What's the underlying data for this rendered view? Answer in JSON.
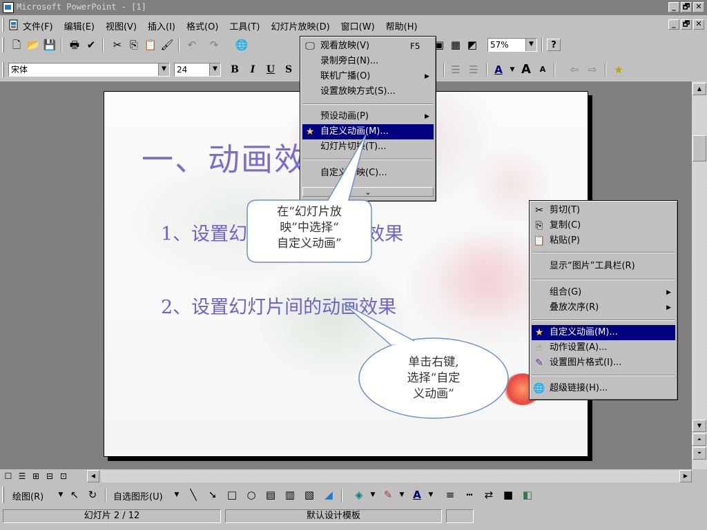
{
  "window": {
    "title": "Microsoft PowerPoint - [1]",
    "controls": [
      "_",
      "🗗",
      "✕"
    ]
  },
  "menubar": {
    "items": [
      "文件(F)",
      "编辑(E)",
      "视图(V)",
      "插入(I)",
      "格式(O)",
      "工具(T)",
      "幻灯片放映(D)",
      "窗口(W)",
      "帮助(H)"
    ]
  },
  "std_toolbar": {
    "zoom": "57%"
  },
  "fmt_toolbar": {
    "font": "宋体",
    "size": "24",
    "bold": "B",
    "italic": "I",
    "underline": "U",
    "shadow": "S"
  },
  "slideshow_menu": {
    "items": [
      {
        "label": "观看放映(V)",
        "shortcut": "F5"
      },
      {
        "label": "录制旁白(N)..."
      },
      {
        "label": "联机广播(O)"
      },
      {
        "label": "设置放映方式(S)..."
      },
      {
        "label": "预设动画(P)"
      },
      {
        "label": "自定义动画(M)..."
      },
      {
        "label": "幻灯片切换(T)..."
      },
      {
        "label": "自定义放映(C)..."
      }
    ],
    "expand": "⌄"
  },
  "context_menu": {
    "items": [
      {
        "label": "剪切(T)"
      },
      {
        "label": "复制(C)"
      },
      {
        "label": "粘贴(P)"
      },
      {
        "label": "显示“图片”工具栏(R)"
      },
      {
        "label": "组合(G)"
      },
      {
        "label": "叠放次序(R)"
      },
      {
        "label": "自定义动画(M)..."
      },
      {
        "label": "动作设置(A)..."
      },
      {
        "label": "设置图片格式(I)..."
      },
      {
        "label": "超级链接(H)..."
      }
    ]
  },
  "slide": {
    "title": "一、动画效",
    "bullet1": "1、设置幻",
    "bullet1_tail": "画效果",
    "bullet2": "2、设置幻灯片间的动画效果"
  },
  "callouts": {
    "menu_hint": "在“幻灯片放映”中选择“自定义动画”",
    "menu_hint_lines": [
      "在“幻灯片放",
      "映”中选择“",
      "自定义动画”"
    ],
    "context_hint_lines": [
      "单击右键,",
      "选择“自定",
      "义动画”"
    ]
  },
  "draw_toolbar": {
    "draw": "绘图(R)",
    "autoshapes": "自选图形(U)"
  },
  "statusbar": {
    "slide": "幻灯片 2 / 12",
    "template": "默认设计模板"
  },
  "colors": {
    "highlight": "#000080",
    "slide_text": "#7a6fd0",
    "callout_fill": "#ffffff",
    "callout_stroke": "#6f8fc8"
  }
}
